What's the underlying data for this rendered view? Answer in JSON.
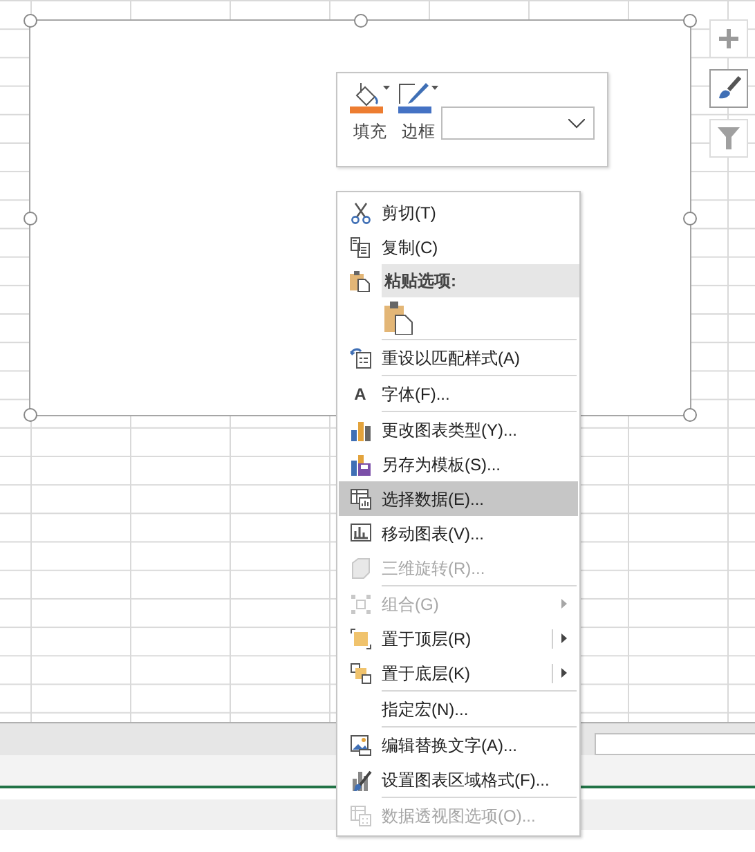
{
  "mini_toolbar": {
    "buttons": [
      {
        "label": "填充",
        "kind": "fill"
      },
      {
        "label": "边框",
        "kind": "border"
      }
    ]
  },
  "side_buttons": [
    {
      "kind": "plus"
    },
    {
      "kind": "brush"
    },
    {
      "kind": "filter"
    }
  ],
  "context_menu": {
    "items": [
      {
        "kind": "item",
        "label": "剪切(T)",
        "disabled": false,
        "selected": false,
        "submenu": false
      },
      {
        "kind": "item",
        "label": "复制(C)",
        "disabled": false,
        "selected": false,
        "submenu": false
      },
      {
        "kind": "header",
        "label": "粘贴选项:"
      },
      {
        "kind": "paste"
      },
      {
        "kind": "separator"
      },
      {
        "kind": "item",
        "label": "重设以匹配样式(A)",
        "disabled": false,
        "selected": false,
        "submenu": false
      },
      {
        "kind": "separator"
      },
      {
        "kind": "item",
        "glyph": "A",
        "label": "字体(F)...",
        "disabled": false,
        "selected": false,
        "submenu": false
      },
      {
        "kind": "separator"
      },
      {
        "kind": "item",
        "label": "更改图表类型(Y)...",
        "disabled": false,
        "selected": false,
        "submenu": false
      },
      {
        "kind": "item",
        "label": "另存为模板(S)...",
        "disabled": false,
        "selected": false,
        "submenu": false
      },
      {
        "kind": "item",
        "label": "选择数据(E)...",
        "disabled": false,
        "selected": true,
        "submenu": false
      },
      {
        "kind": "item",
        "label": "移动图表(V)...",
        "disabled": false,
        "selected": false,
        "submenu": false
      },
      {
        "kind": "item",
        "label": "三维旋转(R)...",
        "disabled": true,
        "selected": false,
        "submenu": false
      },
      {
        "kind": "separator"
      },
      {
        "kind": "item",
        "label": "组合(G)",
        "disabled": true,
        "selected": false,
        "submenu": true
      },
      {
        "kind": "item",
        "label": "置于顶层(R)",
        "disabled": false,
        "selected": false,
        "submenu": true
      },
      {
        "kind": "item",
        "label": "置于底层(K)",
        "disabled": false,
        "selected": false,
        "submenu": true
      },
      {
        "kind": "separator"
      },
      {
        "kind": "item",
        "label": "指定宏(N)...",
        "disabled": false,
        "selected": false,
        "submenu": false
      },
      {
        "kind": "separator"
      },
      {
        "kind": "item",
        "label": "编辑替换文字(A)...",
        "disabled": false,
        "selected": false,
        "submenu": false
      },
      {
        "kind": "item",
        "label": "设置图表区域格式(F)...",
        "disabled": false,
        "selected": false,
        "submenu": false
      },
      {
        "kind": "separator"
      },
      {
        "kind": "item",
        "label": "数据透视图选项(O)...",
        "disabled": true,
        "selected": false,
        "submenu": false
      }
    ]
  }
}
